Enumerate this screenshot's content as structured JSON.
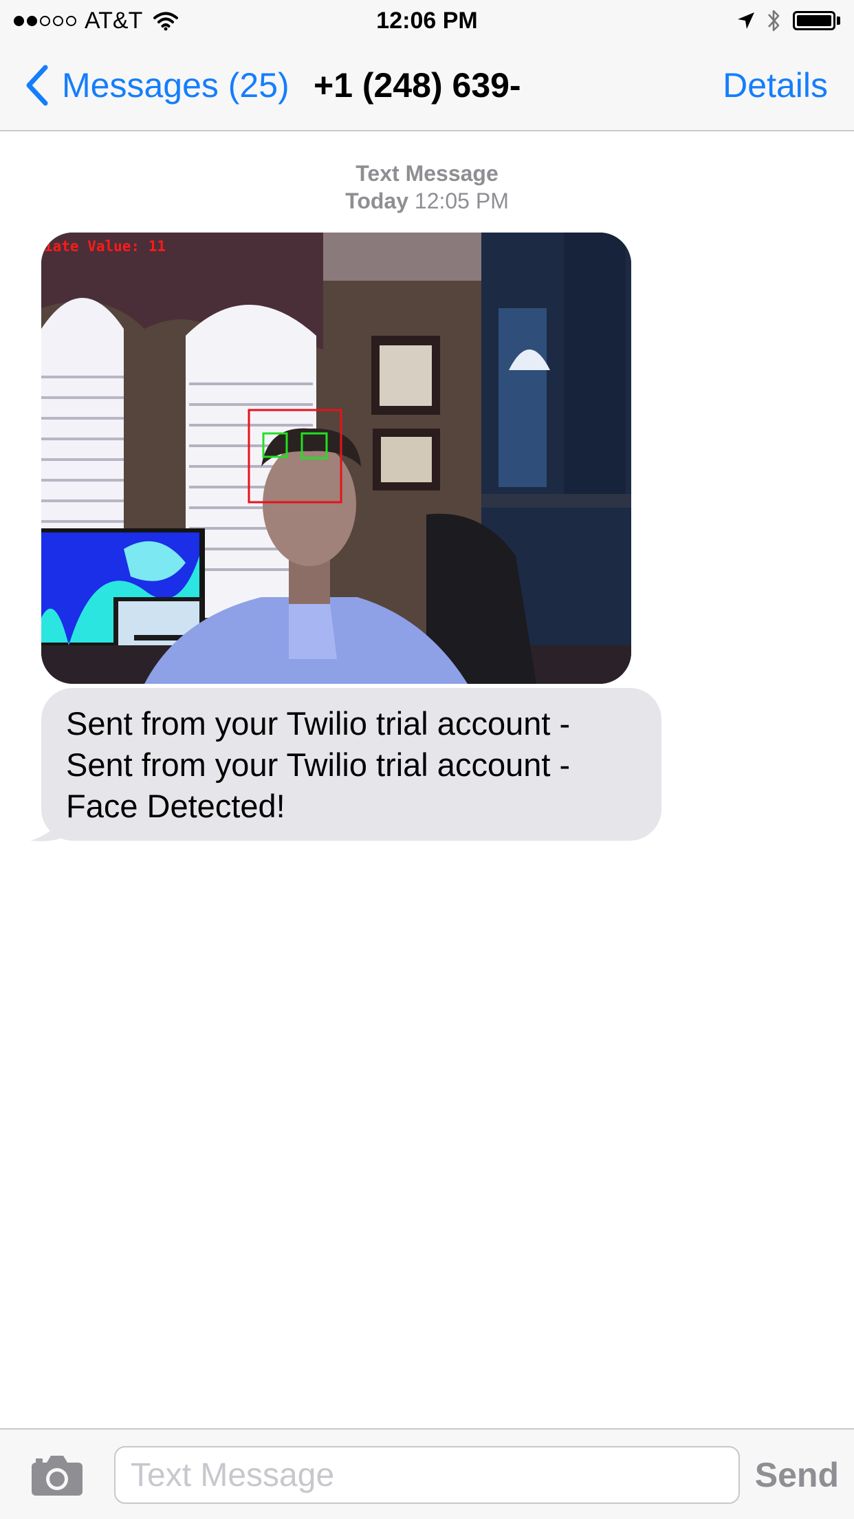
{
  "status_bar": {
    "carrier": "AT&T",
    "time": "12:06 PM",
    "signal_bars_filled": 2,
    "signal_bars_total": 5,
    "battery_level": 1.0
  },
  "nav_bar": {
    "back_label": "Messages (25)",
    "title": "+1 (248) 639-",
    "details_label": "Details"
  },
  "conversation": {
    "type_label": "Text Message",
    "day_label": "Today",
    "time_label": "12:05 PM"
  },
  "image_message": {
    "overlay_text": "iate Value: 11"
  },
  "text_message": {
    "lines": [
      "Sent from your Twilio trial account -",
      "Sent from your Twilio trial account -",
      "Face Detected!"
    ]
  },
  "input_bar": {
    "placeholder": "Text Message",
    "send_label": "Send"
  },
  "colors": {
    "ios_blue": "#157efb",
    "bubble_gray": "#e5e5ea",
    "label_gray": "#8e8e93",
    "face_box": "#e8121b",
    "eye_box": "#22e022"
  },
  "icons": {
    "back": "chevron-left-icon",
    "wifi": "wifi-icon",
    "location": "location-arrow-icon",
    "bluetooth": "bluetooth-icon",
    "battery": "battery-icon",
    "camera": "camera-icon"
  }
}
